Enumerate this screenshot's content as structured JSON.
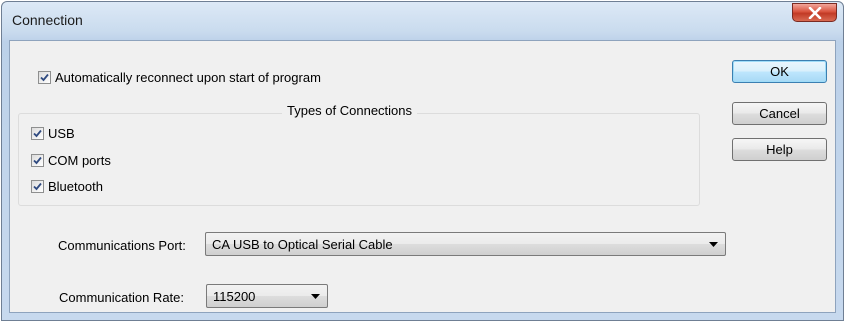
{
  "window": {
    "title": "Connection"
  },
  "options": {
    "auto_reconnect_label": "Automatically reconnect upon start of program",
    "auto_reconnect_checked": true
  },
  "connection_types": {
    "title": "Types of Connections",
    "items": [
      {
        "label": "USB",
        "checked": true
      },
      {
        "label": "COM ports",
        "checked": true
      },
      {
        "label": "Bluetooth",
        "checked": true
      }
    ]
  },
  "buttons": {
    "ok": "OK",
    "cancel": "Cancel",
    "help": "Help"
  },
  "fields": {
    "port_label": "Communications Port:",
    "port_value": "CA USB to Optical Serial Cable",
    "rate_label": "Communication Rate:",
    "rate_value": "115200"
  },
  "colors": {
    "title_bar": "#c9dbee",
    "close_button": "#c8422c",
    "default_button_border": "#3c7fb1"
  },
  "icons": {
    "close": "close-icon",
    "check": "checkmark-icon",
    "dropdown": "chevron-down-icon"
  }
}
